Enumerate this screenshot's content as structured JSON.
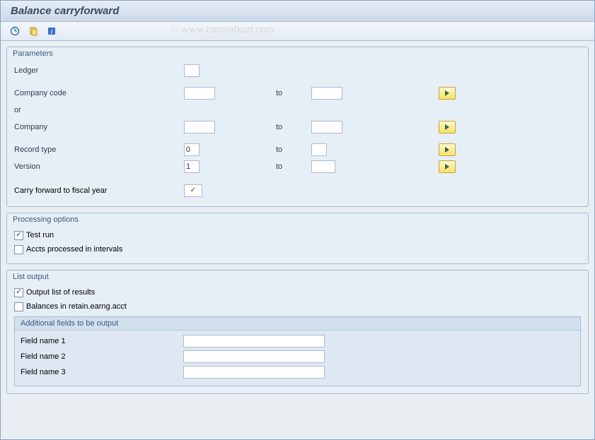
{
  "title": "Balance carryforward",
  "toolbar": {
    "execute_icon": "execute-icon",
    "variant_icon": "variant-icon",
    "info_icon": "info-icon"
  },
  "watermark": "© www.tutorialkart.com",
  "parameters": {
    "title": "Parameters",
    "ledger": {
      "label": "Ledger",
      "value": ""
    },
    "company_code": {
      "label": "Company code",
      "from": "",
      "to_label": "to",
      "to": ""
    },
    "or_label": "or",
    "company": {
      "label": "Company",
      "from": "",
      "to_label": "to",
      "to": ""
    },
    "record_type": {
      "label": "Record type",
      "from": "0",
      "to_label": "to",
      "to": ""
    },
    "version": {
      "label": "Version",
      "from": "1",
      "to_label": "to",
      "to": ""
    },
    "carry_forward": {
      "label": "Carry forward to fiscal year",
      "checked": true
    }
  },
  "processing": {
    "title": "Processing options",
    "test_run": {
      "label": "Test run",
      "checked": true
    },
    "accts_intervals": {
      "label": "Accts processed in intervals",
      "checked": false
    }
  },
  "list_output": {
    "title": "List output",
    "output_list": {
      "label": "Output list of results",
      "checked": true
    },
    "balances_retained": {
      "label": "Balances in retain.earng.acct",
      "checked": false
    },
    "additional": {
      "title": "Additional fields to be output",
      "field1": {
        "label": "Field name 1",
        "value": ""
      },
      "field2": {
        "label": "Field name 2",
        "value": ""
      },
      "field3": {
        "label": "Field name 3",
        "value": ""
      }
    }
  }
}
